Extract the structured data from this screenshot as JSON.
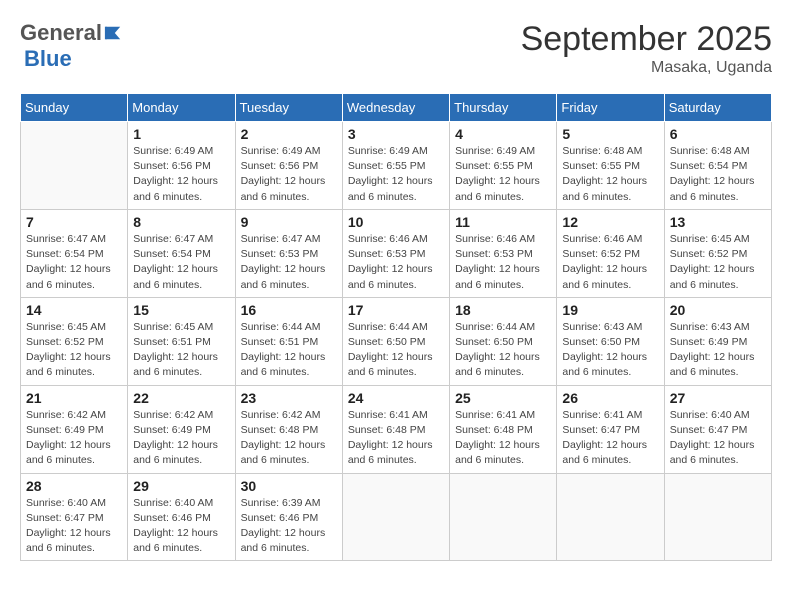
{
  "logo": {
    "general": "General",
    "blue": "Blue"
  },
  "title": "September 2025",
  "location": "Masaka, Uganda",
  "days_of_week": [
    "Sunday",
    "Monday",
    "Tuesday",
    "Wednesday",
    "Thursday",
    "Friday",
    "Saturday"
  ],
  "weeks": [
    [
      {
        "day": "",
        "info": ""
      },
      {
        "day": "1",
        "info": "Sunrise: 6:49 AM\nSunset: 6:56 PM\nDaylight: 12 hours\nand 6 minutes."
      },
      {
        "day": "2",
        "info": "Sunrise: 6:49 AM\nSunset: 6:56 PM\nDaylight: 12 hours\nand 6 minutes."
      },
      {
        "day": "3",
        "info": "Sunrise: 6:49 AM\nSunset: 6:55 PM\nDaylight: 12 hours\nand 6 minutes."
      },
      {
        "day": "4",
        "info": "Sunrise: 6:49 AM\nSunset: 6:55 PM\nDaylight: 12 hours\nand 6 minutes."
      },
      {
        "day": "5",
        "info": "Sunrise: 6:48 AM\nSunset: 6:55 PM\nDaylight: 12 hours\nand 6 minutes."
      },
      {
        "day": "6",
        "info": "Sunrise: 6:48 AM\nSunset: 6:54 PM\nDaylight: 12 hours\nand 6 minutes."
      }
    ],
    [
      {
        "day": "7",
        "info": "Sunrise: 6:47 AM\nSunset: 6:54 PM\nDaylight: 12 hours\nand 6 minutes."
      },
      {
        "day": "8",
        "info": "Sunrise: 6:47 AM\nSunset: 6:54 PM\nDaylight: 12 hours\nand 6 minutes."
      },
      {
        "day": "9",
        "info": "Sunrise: 6:47 AM\nSunset: 6:53 PM\nDaylight: 12 hours\nand 6 minutes."
      },
      {
        "day": "10",
        "info": "Sunrise: 6:46 AM\nSunset: 6:53 PM\nDaylight: 12 hours\nand 6 minutes."
      },
      {
        "day": "11",
        "info": "Sunrise: 6:46 AM\nSunset: 6:53 PM\nDaylight: 12 hours\nand 6 minutes."
      },
      {
        "day": "12",
        "info": "Sunrise: 6:46 AM\nSunset: 6:52 PM\nDaylight: 12 hours\nand 6 minutes."
      },
      {
        "day": "13",
        "info": "Sunrise: 6:45 AM\nSunset: 6:52 PM\nDaylight: 12 hours\nand 6 minutes."
      }
    ],
    [
      {
        "day": "14",
        "info": "Sunrise: 6:45 AM\nSunset: 6:52 PM\nDaylight: 12 hours\nand 6 minutes."
      },
      {
        "day": "15",
        "info": "Sunrise: 6:45 AM\nSunset: 6:51 PM\nDaylight: 12 hours\nand 6 minutes."
      },
      {
        "day": "16",
        "info": "Sunrise: 6:44 AM\nSunset: 6:51 PM\nDaylight: 12 hours\nand 6 minutes."
      },
      {
        "day": "17",
        "info": "Sunrise: 6:44 AM\nSunset: 6:50 PM\nDaylight: 12 hours\nand 6 minutes."
      },
      {
        "day": "18",
        "info": "Sunrise: 6:44 AM\nSunset: 6:50 PM\nDaylight: 12 hours\nand 6 minutes."
      },
      {
        "day": "19",
        "info": "Sunrise: 6:43 AM\nSunset: 6:50 PM\nDaylight: 12 hours\nand 6 minutes."
      },
      {
        "day": "20",
        "info": "Sunrise: 6:43 AM\nSunset: 6:49 PM\nDaylight: 12 hours\nand 6 minutes."
      }
    ],
    [
      {
        "day": "21",
        "info": "Sunrise: 6:42 AM\nSunset: 6:49 PM\nDaylight: 12 hours\nand 6 minutes."
      },
      {
        "day": "22",
        "info": "Sunrise: 6:42 AM\nSunset: 6:49 PM\nDaylight: 12 hours\nand 6 minutes."
      },
      {
        "day": "23",
        "info": "Sunrise: 6:42 AM\nSunset: 6:48 PM\nDaylight: 12 hours\nand 6 minutes."
      },
      {
        "day": "24",
        "info": "Sunrise: 6:41 AM\nSunset: 6:48 PM\nDaylight: 12 hours\nand 6 minutes."
      },
      {
        "day": "25",
        "info": "Sunrise: 6:41 AM\nSunset: 6:48 PM\nDaylight: 12 hours\nand 6 minutes."
      },
      {
        "day": "26",
        "info": "Sunrise: 6:41 AM\nSunset: 6:47 PM\nDaylight: 12 hours\nand 6 minutes."
      },
      {
        "day": "27",
        "info": "Sunrise: 6:40 AM\nSunset: 6:47 PM\nDaylight: 12 hours\nand 6 minutes."
      }
    ],
    [
      {
        "day": "28",
        "info": "Sunrise: 6:40 AM\nSunset: 6:47 PM\nDaylight: 12 hours\nand 6 minutes."
      },
      {
        "day": "29",
        "info": "Sunrise: 6:40 AM\nSunset: 6:46 PM\nDaylight: 12 hours\nand 6 minutes."
      },
      {
        "day": "30",
        "info": "Sunrise: 6:39 AM\nSunset: 6:46 PM\nDaylight: 12 hours\nand 6 minutes."
      },
      {
        "day": "",
        "info": ""
      },
      {
        "day": "",
        "info": ""
      },
      {
        "day": "",
        "info": ""
      },
      {
        "day": "",
        "info": ""
      }
    ]
  ]
}
